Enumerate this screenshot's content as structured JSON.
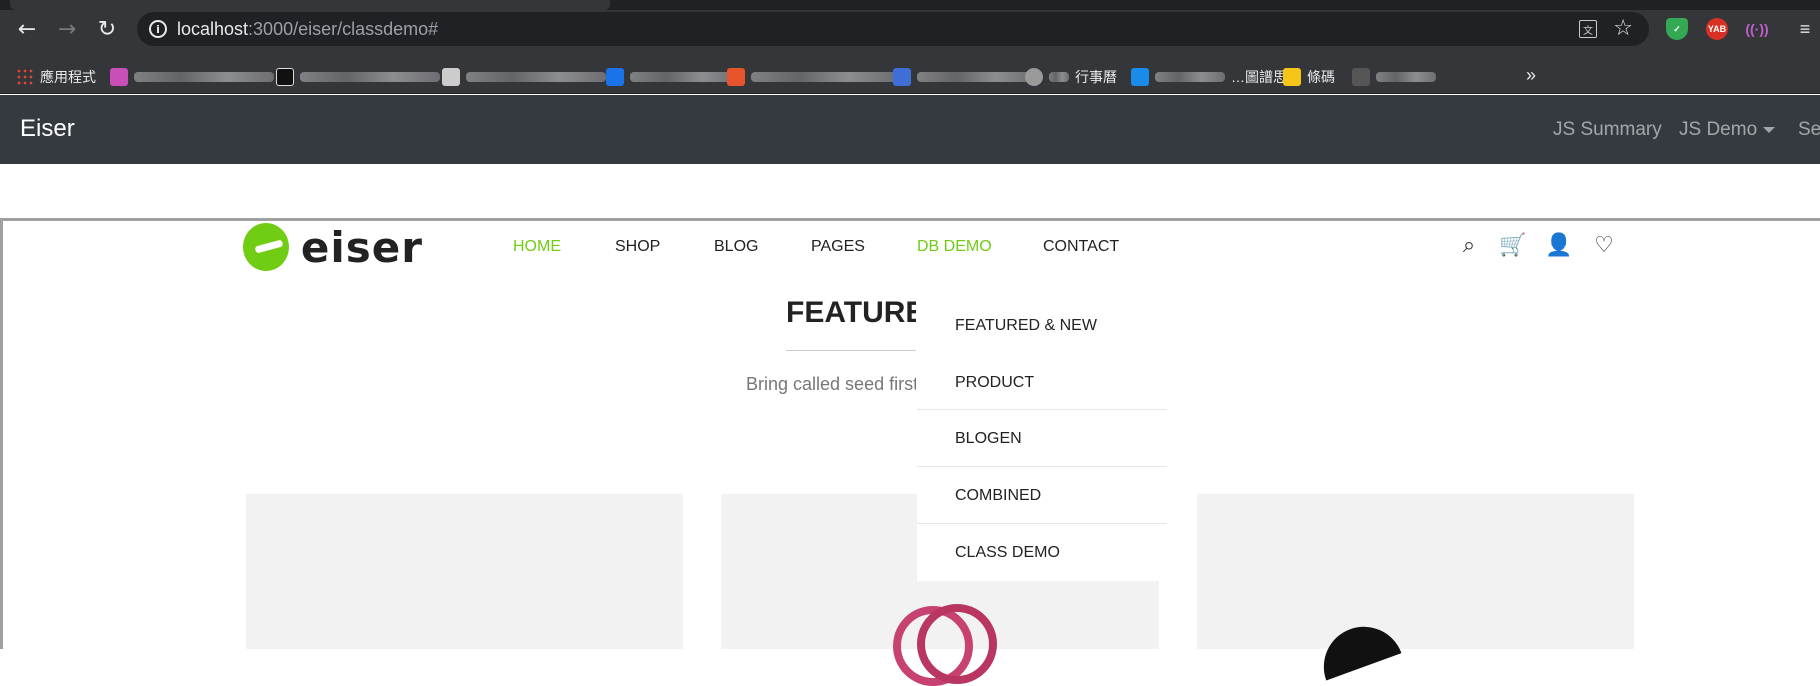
{
  "browser": {
    "url_host": "localhost",
    "url_rest": ":3000/eiser/classdemo#",
    "bookmarks": [
      {
        "label": "應用程式"
      },
      {
        "label": ""
      },
      {
        "label": ""
      },
      {
        "label": ""
      },
      {
        "label": ""
      },
      {
        "label": ""
      },
      {
        "label": ""
      },
      {
        "label": "…"
      },
      {
        "label": "行事曆"
      },
      {
        "label": "…圖譜思"
      },
      {
        "label": "條碼"
      },
      {
        "label": ""
      }
    ],
    "ext_yab": "YAB",
    "more": "»"
  },
  "app_navbar": {
    "brand": "Eiser",
    "links": {
      "summary": "JS Summary",
      "demo": "JS Demo",
      "se": "Se"
    }
  },
  "site": {
    "logo_text": "eiser",
    "menu": {
      "home": "HOME",
      "shop": "SHOP",
      "blog": "BLOG",
      "pages": "PAGES",
      "db_demo": "DB DEMO",
      "contact": "CONTACT"
    },
    "section_title": "FEATURED",
    "subtitle": "Bring called seed first",
    "dropdown": [
      "FEATURED & NEW",
      "PRODUCT",
      "BLOGEN",
      "COMBINED",
      "CLASS DEMO"
    ]
  },
  "colors": {
    "accent": "#71cd14",
    "navbar_bg": "#343a40",
    "chrome_bg": "#35363a"
  }
}
